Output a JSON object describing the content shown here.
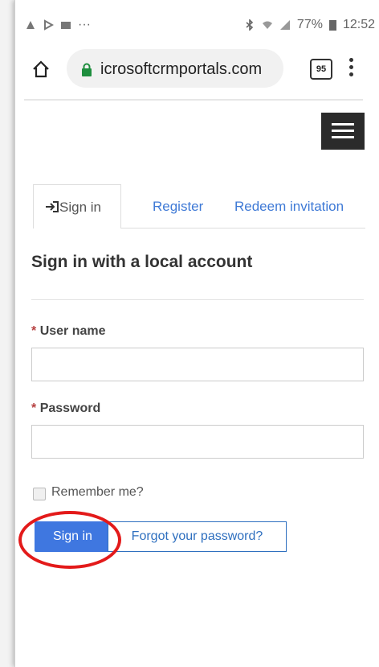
{
  "status_bar": {
    "left_dots": "···",
    "battery": "77%",
    "time": "12:52"
  },
  "browser": {
    "url": "icrosoftcrmportals.com",
    "tab_count": "95"
  },
  "tabs": [
    {
      "label": "Sign in",
      "active": true
    },
    {
      "label": "Register",
      "active": false
    },
    {
      "label": "Redeem invitation",
      "active": false
    }
  ],
  "form": {
    "heading": "Sign in with a local account",
    "required_mark": "*",
    "username_label": "User name",
    "username_value": "",
    "password_label": "Password",
    "password_value": "",
    "remember_label": "Remember me?",
    "remember_checked": false,
    "signin_button": "Sign in",
    "forgot_button": "Forgot your password?"
  },
  "colors": {
    "primary": "#3f77e0",
    "link": "#3f7ad6",
    "annotation": "#e31a1a"
  }
}
